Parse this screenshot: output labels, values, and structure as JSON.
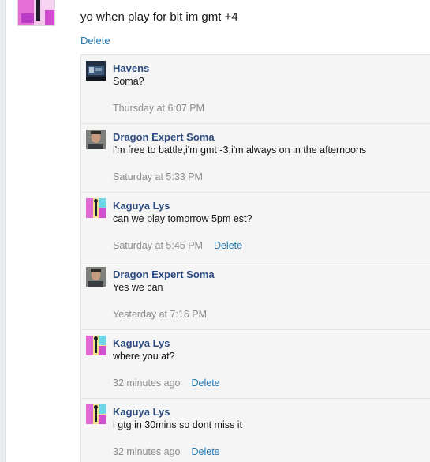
{
  "post": {
    "message": "yo when play for blt im gmt +4",
    "delete_label": "Delete"
  },
  "replies": [
    {
      "author": "Havens",
      "text": "Soma?",
      "time": "Thursday at 6:07 PM",
      "delete": ""
    },
    {
      "author": "Dragon Expert Soma",
      "text": "i'm free to battle,i'm gmt -3,i'm always on in the afternoons",
      "time": "Saturday at 5:33 PM",
      "delete": ""
    },
    {
      "author": "Kaguya Lys",
      "text": "can we play tomorrow 5pm est?",
      "time": "Saturday at 5:45 PM",
      "delete": "Delete"
    },
    {
      "author": "Dragon Expert Soma",
      "text": "Yes we can",
      "time": "Yesterday at 7:16 PM",
      "delete": ""
    },
    {
      "author": "Kaguya Lys",
      "text": "where you at?",
      "time": "32 minutes ago",
      "delete": "Delete"
    },
    {
      "author": "Kaguya Lys",
      "text": "i gtg in 30mins so dont miss it",
      "time": "32 minutes ago",
      "delete": "Delete"
    }
  ],
  "colors": {
    "link": "#2577b1",
    "author": "#2b4b80",
    "thread_bg": "#f5f5f5",
    "muted": "#8c8c8c"
  }
}
